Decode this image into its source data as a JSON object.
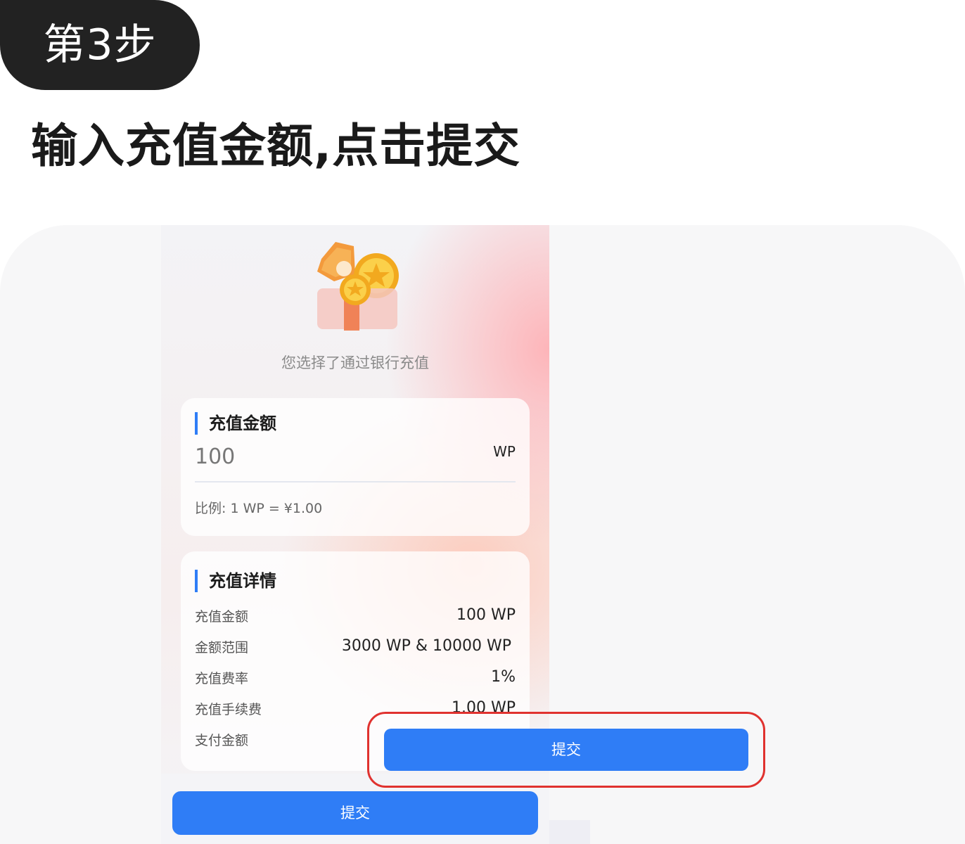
{
  "step": {
    "label": "第3步"
  },
  "heading": "输入充值金额,点击提交",
  "phone": {
    "illustration_icon": "gift-coins-icon",
    "caption": "您选择了通过银行充值",
    "amount_card": {
      "title": "充值金额",
      "amount_value": "100",
      "amount_unit": "WP",
      "ratio": "比例: 1 WP = ¥1.00"
    },
    "details_card": {
      "title": "充值详情",
      "rows": [
        {
          "label": "充值金额",
          "value": "100 WP"
        },
        {
          "label": "金额范围",
          "value": "3000 WP & 10000 WP"
        },
        {
          "label": "充值费率",
          "value": "1%"
        },
        {
          "label": "充值手续费",
          "value": "1.00 WP"
        },
        {
          "label": "支付金额",
          "value": ""
        }
      ]
    },
    "bottom_submit_label": "提交"
  },
  "highlight": {
    "submit_label": "提交",
    "border_color": "#e0322f"
  },
  "colors": {
    "accent": "#2f7df6",
    "pill": "#222222"
  }
}
